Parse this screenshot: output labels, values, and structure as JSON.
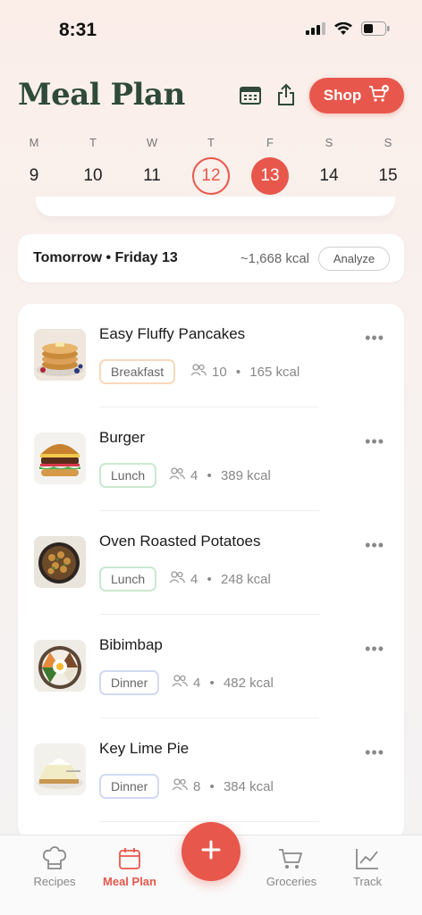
{
  "status": {
    "time": "8:31"
  },
  "header": {
    "title": "Meal Plan",
    "shop_label": "Shop"
  },
  "week": [
    {
      "letter": "M",
      "day": "9"
    },
    {
      "letter": "T",
      "day": "10"
    },
    {
      "letter": "W",
      "day": "11"
    },
    {
      "letter": "T",
      "day": "12"
    },
    {
      "letter": "F",
      "day": "13"
    },
    {
      "letter": "S",
      "day": "14"
    },
    {
      "letter": "S",
      "day": "15"
    }
  ],
  "summary": {
    "title": "Tomorrow • Friday 13",
    "kcal": "~1,668 kcal",
    "analyze_label": "Analyze"
  },
  "meals": [
    {
      "name": "Easy Fluffy Pancakes",
      "tag": "Breakfast",
      "servings": "10",
      "kcal": "165 kcal"
    },
    {
      "name": "Burger",
      "tag": "Lunch",
      "servings": "4",
      "kcal": "389 kcal"
    },
    {
      "name": "Oven Roasted Potatoes",
      "tag": "Lunch",
      "servings": "4",
      "kcal": "248 kcal"
    },
    {
      "name": "Bibimbap",
      "tag": "Dinner",
      "servings": "4",
      "kcal": "482 kcal"
    },
    {
      "name": "Key Lime Pie",
      "tag": "Dinner",
      "servings": "8",
      "kcal": "384 kcal"
    }
  ],
  "tabs": {
    "recipes": "Recipes",
    "meal_plan": "Meal Plan",
    "groceries": "Groceries",
    "track": "Track"
  },
  "colors": {
    "accent": "#e8574b",
    "title_green": "#2f4a3a"
  }
}
